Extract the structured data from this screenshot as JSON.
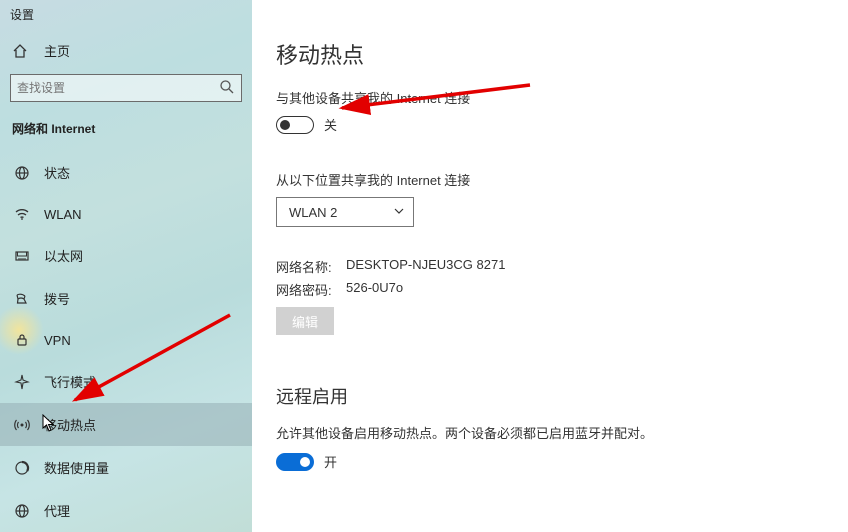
{
  "app_title": "设置",
  "home_label": "主页",
  "search_placeholder": "查找设置",
  "category": "网络和 Internet",
  "nav": [
    {
      "label": "状态"
    },
    {
      "label": "WLAN"
    },
    {
      "label": "以太网"
    },
    {
      "label": "拨号"
    },
    {
      "label": "VPN"
    },
    {
      "label": "飞行模式"
    },
    {
      "label": "移动热点"
    },
    {
      "label": "数据使用量"
    },
    {
      "label": "代理"
    }
  ],
  "page_title": "移动热点",
  "share_label": "与其他设备共享我的 Internet 连接",
  "share_toggle_state": "关",
  "share_from_label": "从以下位置共享我的 Internet 连接",
  "share_from_value": "WLAN 2",
  "net_name_label": "网络名称:",
  "net_name_value": "DESKTOP-NJEU3CG 8271",
  "net_pass_label": "网络密码:",
  "net_pass_value": "526-0U7o",
  "edit_btn_label": "编辑",
  "remote_title": "远程启用",
  "remote_desc": "允许其他设备启用移动热点。两个设备必须都已启用蓝牙并配对。",
  "remote_toggle_state": "开"
}
